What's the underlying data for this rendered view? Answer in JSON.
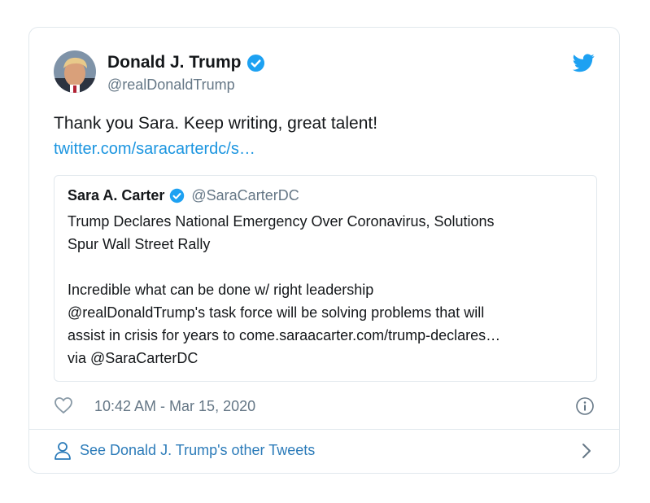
{
  "author": {
    "name": "Donald J. Trump",
    "handle": "@realDonaldTrump"
  },
  "tweet": {
    "text": "Thank you Sara. Keep writing, great talent!",
    "link": "twitter.com/saracarterdc/s…"
  },
  "quoted_tweet": {
    "name": "Sara A. Carter",
    "handle": "@SaraCarterDC",
    "lines": [
      "Trump Declares National Emergency Over Coronavirus, Solutions",
      "Spur Wall Street Rally",
      "Incredible what can be done w/ right leadership",
      "@realDonaldTrump's  task force will be solving problems that will",
      "assist in crisis for years to come.saraacarter.com/trump-declares…",
      "via @SaraCarterDC"
    ]
  },
  "meta": {
    "timestamp": "10:42 AM - Mar 15, 2020"
  },
  "footer": {
    "label": "See Donald J. Trump's other Tweets"
  },
  "icons": [
    "verified-badge-icon",
    "twitter-bird-icon",
    "heart-icon",
    "info-icon",
    "person-icon",
    "chevron-right-icon"
  ],
  "colors": {
    "brand_blue": "#1da1f2",
    "link_blue": "#1b95e0",
    "secondary_text": "#657786",
    "border": "#e1e8ed"
  }
}
